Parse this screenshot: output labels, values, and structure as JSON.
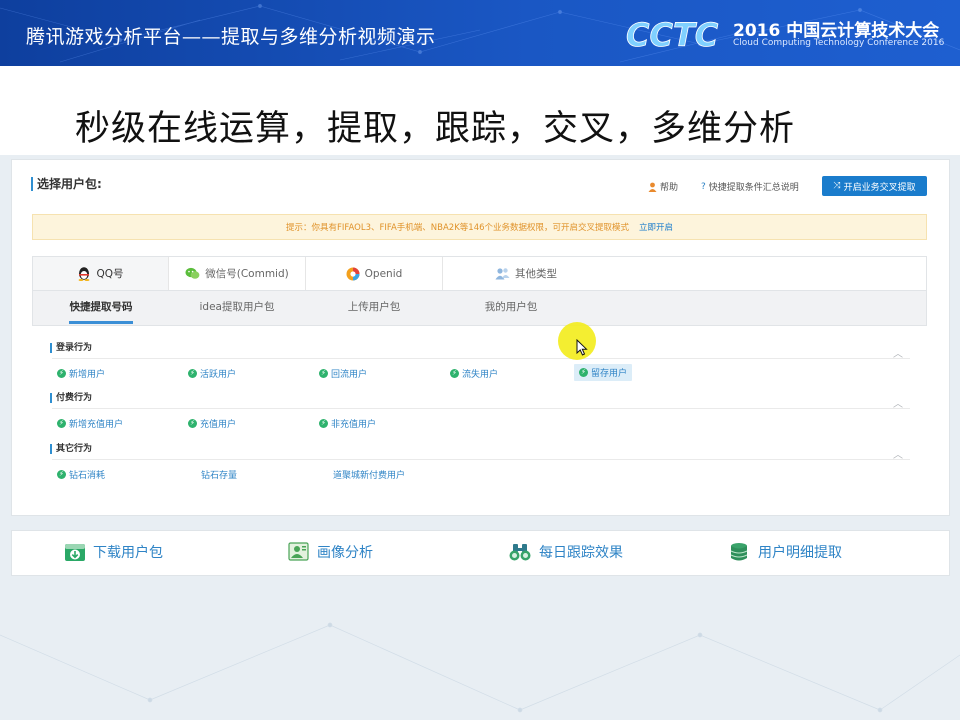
{
  "header": {
    "title": "腾讯游戏分析平台——提取与多维分析视频演示",
    "brand_year": "2016 中国云计算技术大会",
    "brand_sub": "Cloud Computing Technology Conference 2016",
    "logo_text": "CCTC"
  },
  "slide_heading": "秒级在线运算，提取，跟踪，交叉，多维分析",
  "panel": {
    "title": "选择用户包:",
    "help_label": "帮助",
    "quick_label": "快捷提取条件汇总说明",
    "cross_button": "开启业务交叉提取"
  },
  "notice": {
    "text": "提示：你具有FIFAOL3、FIFA手机端、NBA2K等146个业务数据权限，可开启交叉提取模式",
    "link": "立即开启"
  },
  "type_tabs": [
    {
      "label": "QQ号",
      "icon": "qq-penguin-icon"
    },
    {
      "label": "微信号(Commid)",
      "icon": "wechat-icon"
    },
    {
      "label": "Openid",
      "icon": "openid-icon"
    },
    {
      "label": "其他类型",
      "icon": "users-icon"
    }
  ],
  "sub_tabs": [
    "快捷提取号码",
    "idea提取用户包",
    "上传用户包",
    "我的用户包"
  ],
  "groups": [
    {
      "label": "登录行为",
      "items": [
        "新增用户",
        "活跃用户",
        "回流用户",
        "流失用户",
        "留存用户"
      ]
    },
    {
      "label": "付费行为",
      "items": [
        "新增充值用户",
        "充值用户",
        "非充值用户"
      ]
    },
    {
      "label": "其它行为",
      "items": [
        "钻石消耗",
        "钻石存量",
        "道聚城新付费用户"
      ]
    }
  ],
  "actions": [
    {
      "label": "下载用户包",
      "icon": "download-icon"
    },
    {
      "label": "画像分析",
      "icon": "portrait-icon"
    },
    {
      "label": "每日跟踪效果",
      "icon": "binoculars-icon"
    },
    {
      "label": "用户明细提取",
      "icon": "database-icon"
    }
  ],
  "colors": {
    "accent": "#1a7ccc",
    "link": "#2f84c6",
    "banner": "#1552bb",
    "notice_text": "#e0922a",
    "bolt": "#2eb26d"
  }
}
